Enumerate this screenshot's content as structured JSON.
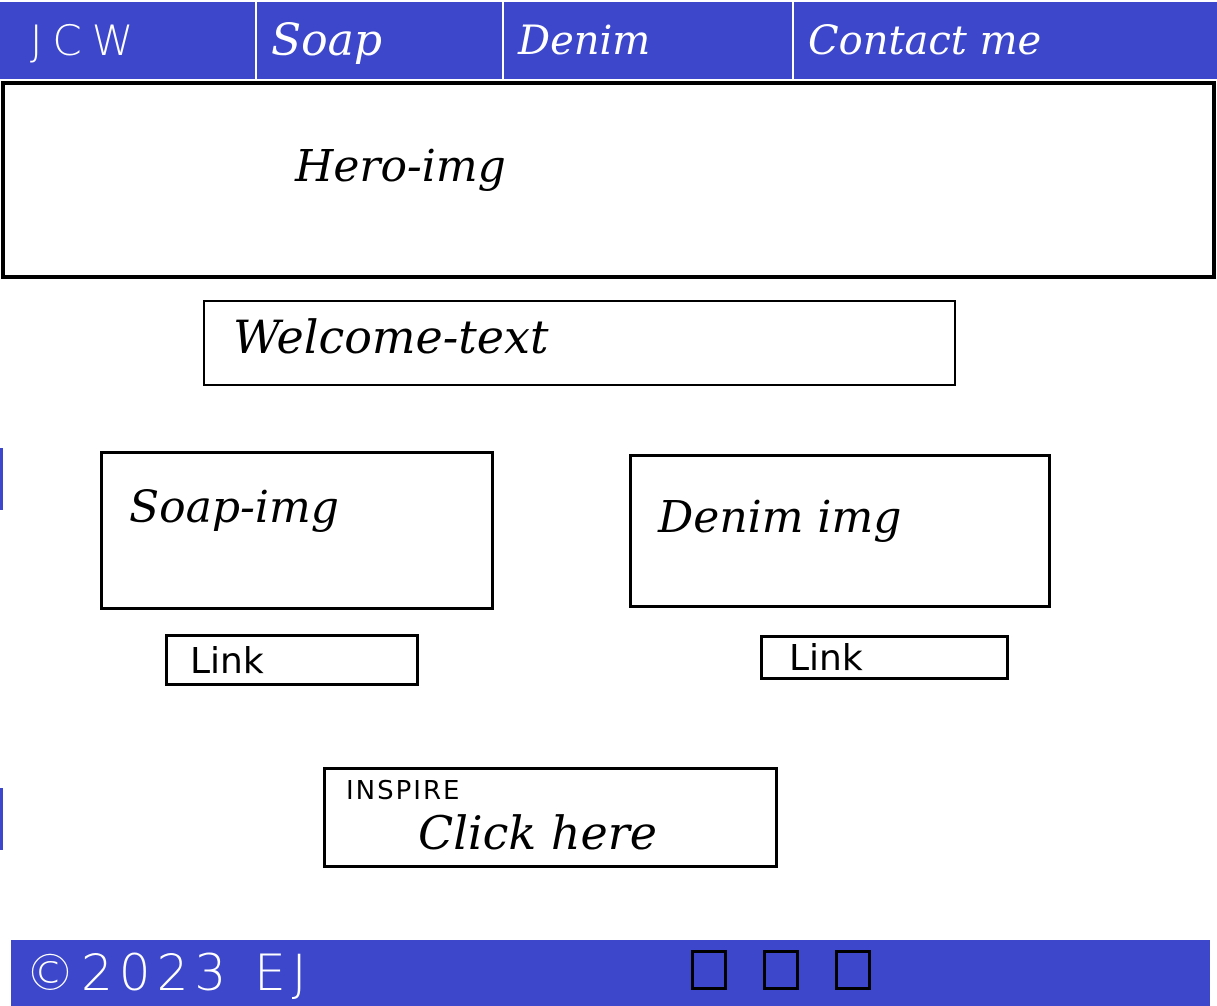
{
  "nav": {
    "brand": "JCW",
    "items": [
      {
        "label": "Soap"
      },
      {
        "label": "Denim"
      },
      {
        "label": "Contact me"
      }
    ]
  },
  "hero": {
    "label": "Hero-img"
  },
  "welcome": {
    "label": "Welcome-text"
  },
  "products": [
    {
      "label": "Soap-img",
      "link_label": "Link"
    },
    {
      "label": "Denim img",
      "link_label": "Link"
    }
  ],
  "inspire": {
    "tag": "INSPIRE",
    "cta": "Click here"
  },
  "footer": {
    "copyright": "©2023 EJ",
    "social_icons": [
      "square-icon",
      "square-icon",
      "square-icon"
    ]
  },
  "colors": {
    "brand_blue": "#3d47cc",
    "ink": "#000000",
    "paper": "#ffffff"
  }
}
